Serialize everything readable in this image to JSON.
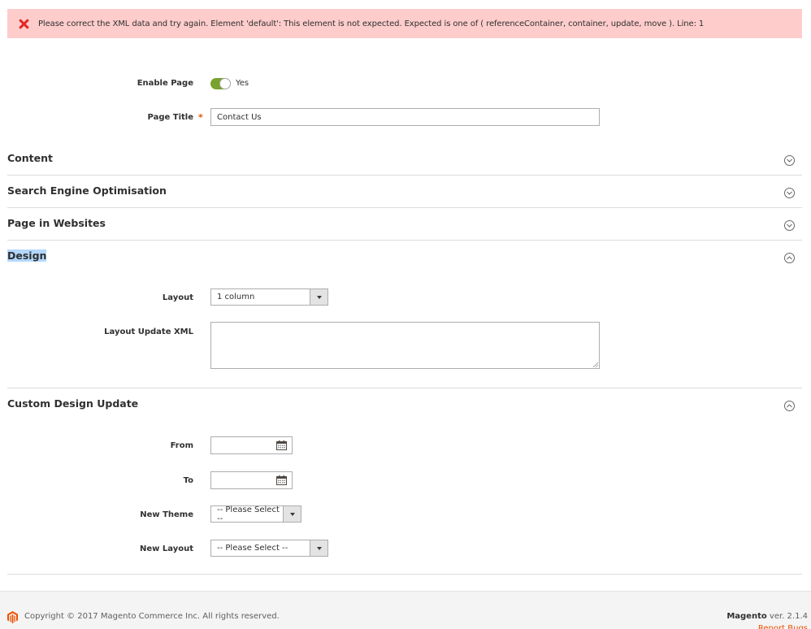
{
  "error_message": {
    "icon": "error-x-icon",
    "text": "Please correct the XML data and try again. Element 'default': This element is not expected. Expected is one of ( referenceContainer, container, update, move ). Line: 1",
    "background": "#fdcccb",
    "icon_color": "#e22626"
  },
  "general": {
    "enable_page": {
      "label": "Enable Page",
      "value_label": "Yes",
      "enabled": true,
      "toggle_color": "#79a22e"
    },
    "page_title": {
      "label": "Page Title",
      "required_mark": "*",
      "value": "Contact Us"
    }
  },
  "sections": [
    {
      "title": "Content",
      "expanded": false,
      "icon": "chevron-down-circle-icon"
    },
    {
      "title": "Search Engine Optimisation",
      "expanded": false,
      "icon": "chevron-down-circle-icon"
    },
    {
      "title": "Page in Websites",
      "expanded": false,
      "icon": "chevron-down-circle-icon"
    },
    {
      "title": "Design",
      "expanded": true,
      "selected_text": true,
      "icon": "chevron-up-circle-icon"
    },
    {
      "title": "Custom Design Update",
      "expanded": true,
      "icon": "chevron-up-circle-icon"
    }
  ],
  "design": {
    "layout": {
      "label": "Layout",
      "value": "1 column"
    },
    "layout_update_xml": {
      "label": "Layout Update XML",
      "value": ""
    }
  },
  "custom_design_update": {
    "from": {
      "label": "From",
      "value": "",
      "icon": "calendar-icon"
    },
    "to": {
      "label": "To",
      "value": "",
      "icon": "calendar-icon"
    },
    "new_theme": {
      "label": "New Theme",
      "value": "-- Please Select --"
    },
    "new_layout": {
      "label": "New Layout",
      "value": "-- Please Select --"
    }
  },
  "footer": {
    "copyright": "Copyright © 2017 Magento Commerce Inc. All rights reserved.",
    "brand": "Magento",
    "version": " ver. 2.1.4",
    "report_bugs": "Report Bugs",
    "accent_color": "#eb5202"
  }
}
